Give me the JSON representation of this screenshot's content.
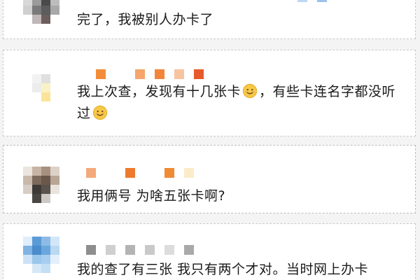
{
  "comments": [
    {
      "text": "完了，我被别人办卡了"
    },
    {
      "text_part1": "我上次查，发现有十几张卡",
      "text_part2": "，有些卡连名字都没听过",
      "emoji": "smiling-face-icon"
    },
    {
      "text": "我用俩号 为啥五张卡啊?"
    },
    {
      "text": "我的查了有三张 我只有两个才对。当时网上办卡"
    }
  ]
}
